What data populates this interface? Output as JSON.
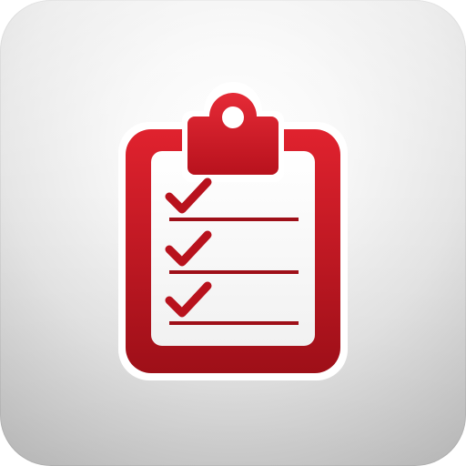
{
  "app_icon": {
    "icon_name": "clipboard-checklist-icon",
    "colors": {
      "accent_red_light": "#e0222e",
      "accent_red_dark": "#9e0f18",
      "tile_light": "#ffffff",
      "tile_dark": "#bdbdbd"
    },
    "checklist": {
      "items": [
        {
          "checked": true
        },
        {
          "checked": true
        },
        {
          "checked": true
        }
      ]
    }
  }
}
